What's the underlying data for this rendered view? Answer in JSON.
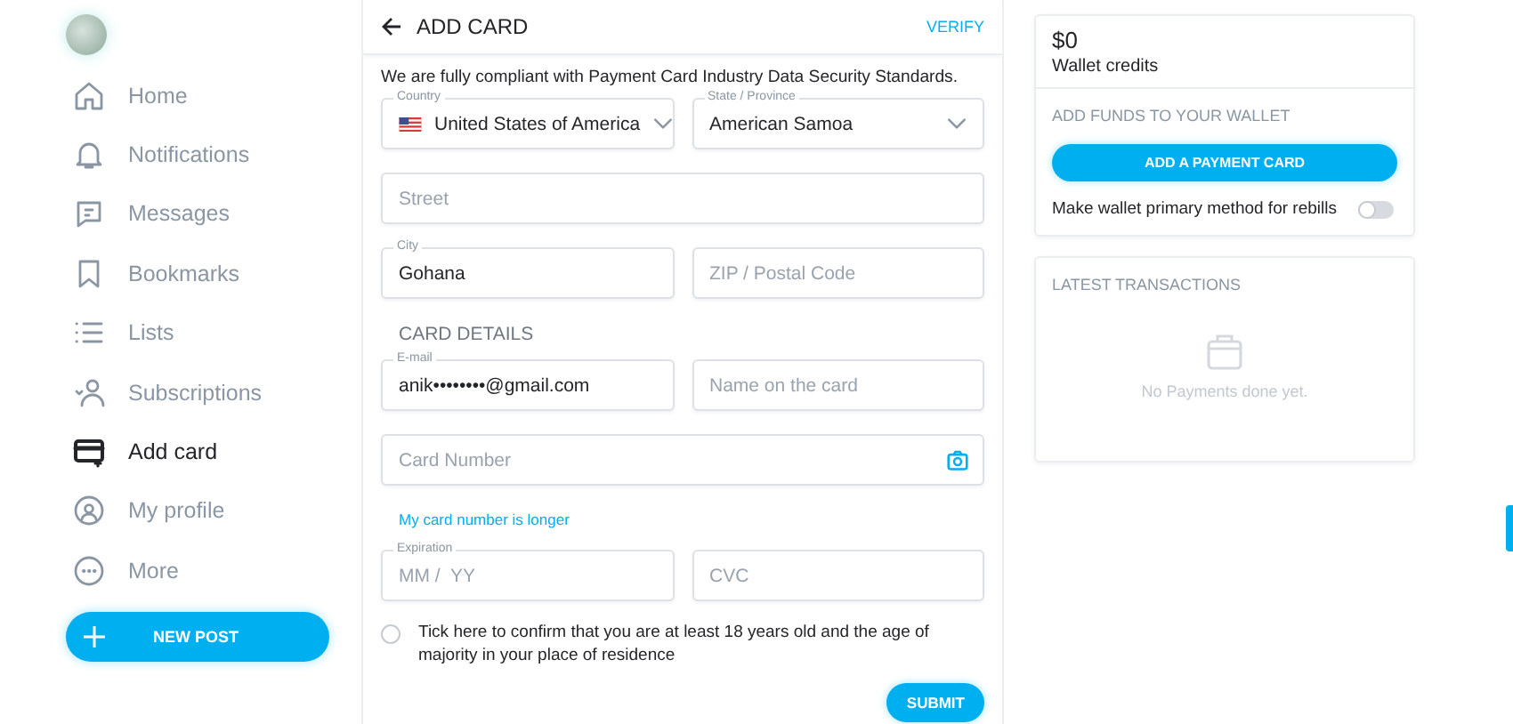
{
  "sidebar": {
    "items": [
      {
        "label": "Home",
        "selected": false
      },
      {
        "label": "Notifications",
        "selected": false
      },
      {
        "label": "Messages",
        "selected": false
      },
      {
        "label": "Bookmarks",
        "selected": false
      },
      {
        "label": "Lists",
        "selected": false
      },
      {
        "label": "Subscriptions",
        "selected": false
      },
      {
        "label": "Add card",
        "selected": true
      },
      {
        "label": "My profile",
        "selected": false
      },
      {
        "label": "More",
        "selected": false
      }
    ],
    "new_post_button": "NEW POST"
  },
  "form": {
    "title": "ADD CARD",
    "verify_link": "VERIFY",
    "notice": "We are fully compliant with Payment Card Industry Data Security Standards.",
    "address_rows": [
      [
        {
          "kind": "select",
          "label": "Country",
          "value": "United States of America",
          "flag": true
        },
        {
          "kind": "select",
          "label": "State / Province",
          "value": "American Samoa"
        }
      ],
      [
        {
          "kind": "text",
          "placeholder": "Street"
        }
      ],
      [
        {
          "kind": "text",
          "label": "City",
          "value": "Gohana"
        },
        {
          "kind": "text",
          "placeholder": "ZIP / Postal Code"
        }
      ]
    ],
    "card_heading": "CARD DETAILS",
    "card_rows": [
      [
        {
          "kind": "text",
          "label": "E-mail",
          "value": "anik••••••••@gmail.com"
        },
        {
          "kind": "text",
          "placeholder": "Name on the card"
        }
      ],
      [
        {
          "kind": "card",
          "placeholder": "Card Number"
        }
      ],
      [
        {
          "kind": "text",
          "label": "Expiration",
          "placeholder": "MM /  YY"
        },
        {
          "kind": "text",
          "placeholder": "CVC"
        }
      ]
    ],
    "longer_link": "My card number is longer",
    "age_checkbox": {
      "label": "Tick here to confirm that you are at least 18 years old and the age of majority in your place of residence",
      "checked": false
    },
    "submit_button": "SUBMIT"
  },
  "wallet": {
    "amount": "$0",
    "caption": "Wallet credits",
    "funds_heading": "ADD FUNDS TO YOUR WALLET",
    "add_card_button": "ADD A PAYMENT CARD",
    "rebill_toggle": {
      "label": "Make wallet primary method for rebills",
      "on": false
    }
  },
  "transactions": {
    "heading": "LATEST TRANSACTIONS",
    "empty_text": "No Payments done yet."
  }
}
